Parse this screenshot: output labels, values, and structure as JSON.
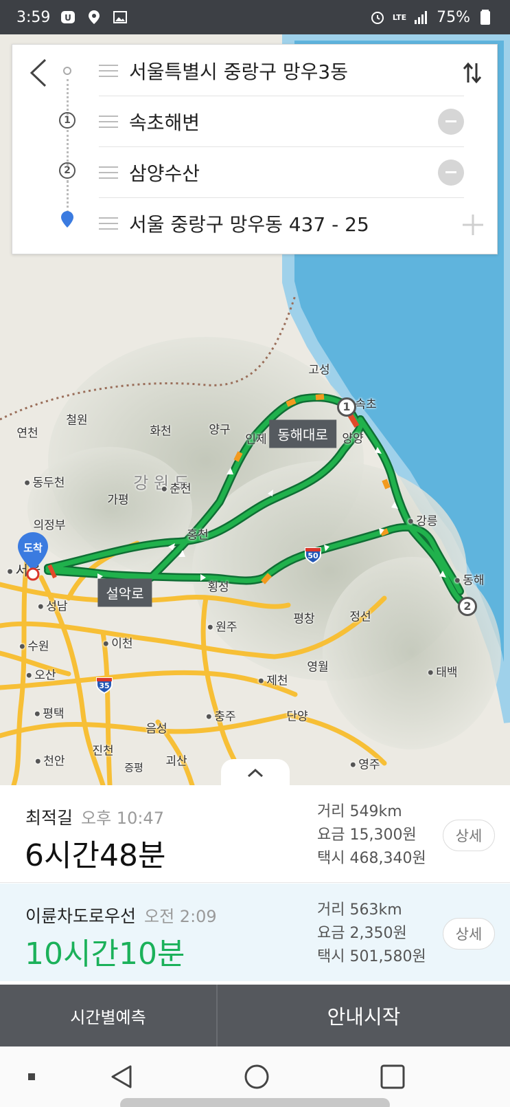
{
  "status_bar": {
    "time": "3:59",
    "battery": "75%",
    "network": "LTE"
  },
  "route_inputs": {
    "origin": "서울특별시 중랑구 망우3동",
    "waypoints": [
      {
        "number": "1",
        "label": "속초해변"
      },
      {
        "number": "2",
        "label": "삼양수산"
      }
    ],
    "destination": "서울 중랑구 망우동 437 - 25"
  },
  "map": {
    "region_label": "강 원 도",
    "places": [
      "고성",
      "속초",
      "양양",
      "인제",
      "양구",
      "화천",
      "철원",
      "연천",
      "동두천",
      "가평",
      "춘천",
      "홍천",
      "서울",
      "성남",
      "횡성",
      "원주",
      "이천",
      "수원",
      "오산",
      "평택",
      "평창",
      "정선",
      "강릉",
      "동해",
      "영월",
      "제천",
      "태백",
      "충주",
      "단양",
      "음성",
      "진천",
      "괴산",
      "천안",
      "영주",
      "증평",
      "의정부",
      "가평"
    ],
    "road_labels": [
      "동해대로",
      "설악로"
    ],
    "highway_shields": [
      "50",
      "35"
    ],
    "arrive_label": "도착",
    "route_color": "#17a34a",
    "congestion_color": "#f29a1f",
    "road_color": "#f7bf36",
    "sea_color": "#5fb4dd"
  },
  "results": [
    {
      "name": "최적길",
      "arrival": "오후 10:47",
      "duration": "6시간48분",
      "distance": "거리 549km",
      "toll": "요금 15,300원",
      "taxi": "택시 468,340원",
      "detail_label": "상세"
    },
    {
      "name": "이륜차도로우선",
      "arrival": "오전 2:09",
      "duration": "10시간10분",
      "distance": "거리 563km",
      "toll": "요금 2,350원",
      "taxi": "택시 501,580원",
      "detail_label": "상세"
    }
  ],
  "actions": {
    "forecast": "시간별예측",
    "start": "안내시작"
  }
}
